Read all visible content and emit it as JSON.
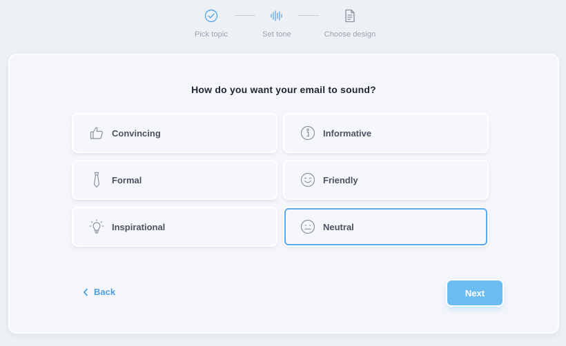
{
  "stepper": {
    "steps": [
      {
        "label": "Pick topic",
        "icon": "check-circle-icon",
        "state": "done"
      },
      {
        "label": "Set tone",
        "icon": "soundwave-icon",
        "state": "current"
      },
      {
        "label": "Choose design",
        "icon": "document-icon",
        "state": "upcoming"
      }
    ]
  },
  "question": "How do you want your email to sound?",
  "options": [
    {
      "label": "Convincing",
      "icon": "thumbs-up-icon",
      "selected": false
    },
    {
      "label": "Informative",
      "icon": "info-icon",
      "selected": false
    },
    {
      "label": "Formal",
      "icon": "tie-icon",
      "selected": false
    },
    {
      "label": "Friendly",
      "icon": "smile-icon",
      "selected": false
    },
    {
      "label": "Inspirational",
      "icon": "lightbulb-icon",
      "selected": false
    },
    {
      "label": "Neutral",
      "icon": "neutral-face-icon",
      "selected": true
    }
  ],
  "nav": {
    "back_label": "Back",
    "next_label": "Next"
  },
  "colors": {
    "accent": "#5aa8ea",
    "next_button": "#6bbcf0",
    "text_dark": "#1e2530",
    "icon_gray": "#8a929e"
  }
}
